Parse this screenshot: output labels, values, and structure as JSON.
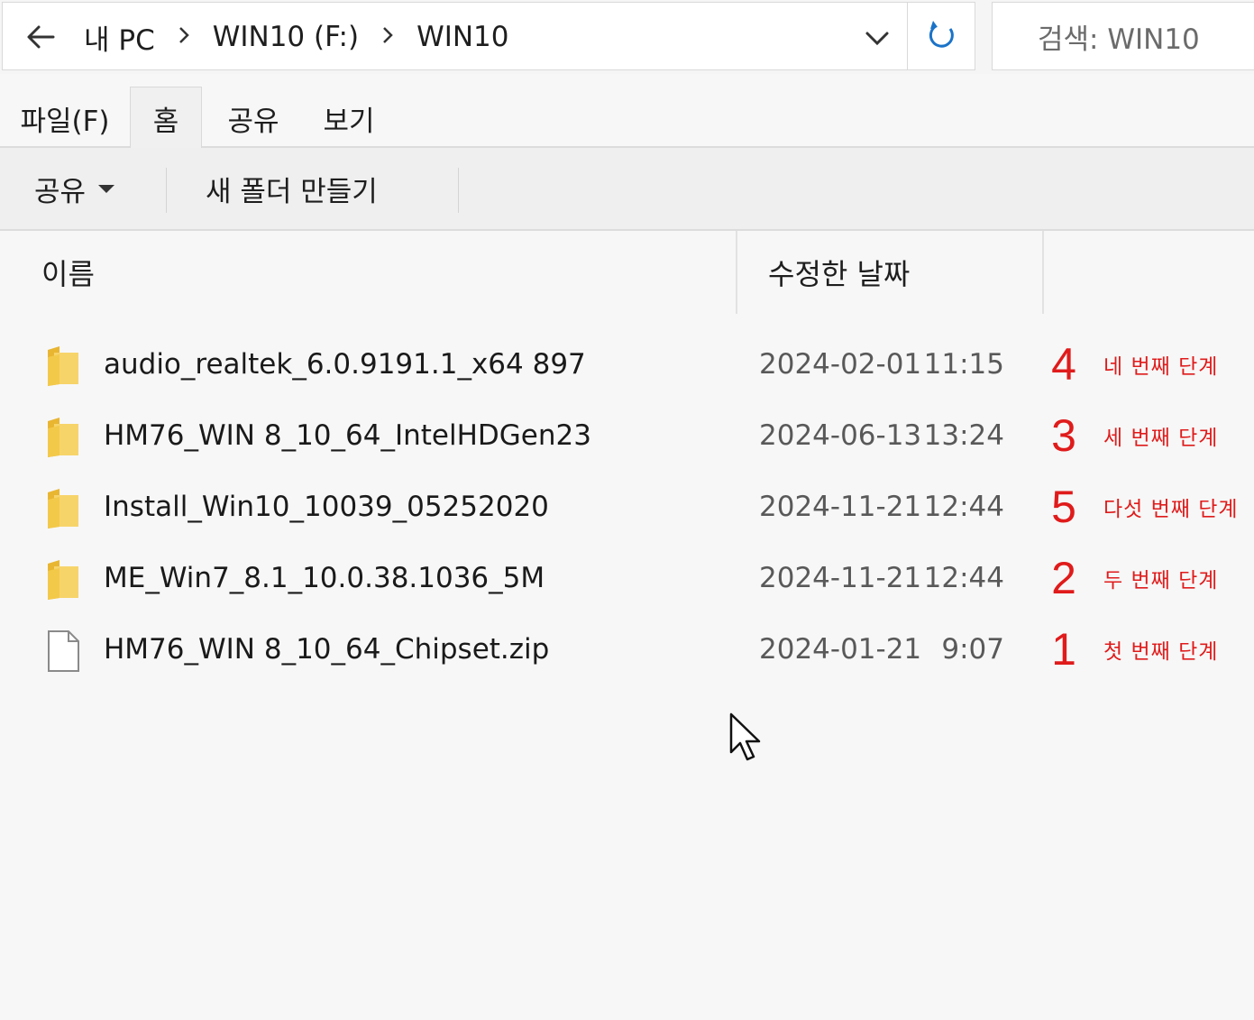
{
  "address_bar": {
    "breadcrumbs": [
      "내 PC",
      "WIN10 (F:)",
      "WIN10"
    ],
    "separator": "›"
  },
  "search": {
    "placeholder": "검색: WIN10"
  },
  "ribbon": {
    "tabs": [
      {
        "label": "파일(F)",
        "active": false
      },
      {
        "label": "홈",
        "active": true
      },
      {
        "label": "공유",
        "active": false
      },
      {
        "label": "보기",
        "active": false
      }
    ],
    "commands": {
      "share_label": "공유",
      "new_folder_label": "새 폴더 만들기"
    }
  },
  "file_list": {
    "columns": {
      "name": "이름",
      "modified": "수정한 날짜"
    },
    "rows": [
      {
        "icon": "folder-icon",
        "name": "audio_realtek_6.0.9191.1_x64 897",
        "date": "2024-02-01",
        "time": "11:15",
        "step_number": "4",
        "step_label": "네 번째 단계"
      },
      {
        "icon": "folder-icon",
        "name": "HM76_WIN 8_10_64_IntelHDGen23",
        "date": "2024-06-13",
        "time": "13:24",
        "step_number": "3",
        "step_label": "세 번째 단계"
      },
      {
        "icon": "folder-icon",
        "name": "Install_Win10_10039_05252020",
        "date": "2024-11-21",
        "time": "12:44",
        "step_number": "5",
        "step_label": "다섯 번째 단계"
      },
      {
        "icon": "folder-icon",
        "name": "ME_Win7_8.1_10.0.38.1036_5M",
        "date": "2024-11-21",
        "time": "12:44",
        "step_number": "2",
        "step_label": "두 번째 단계"
      },
      {
        "icon": "file-icon",
        "name": "HM76_WIN 8_10_64_Chipset.zip",
        "date": "2024-01-21",
        "time": "9:07",
        "step_number": "1",
        "step_label": "첫 번째 단계"
      }
    ]
  },
  "colors": {
    "annotation": "#e01b1b",
    "folder": "#f3c94a",
    "refresh": "#1a73c8"
  }
}
